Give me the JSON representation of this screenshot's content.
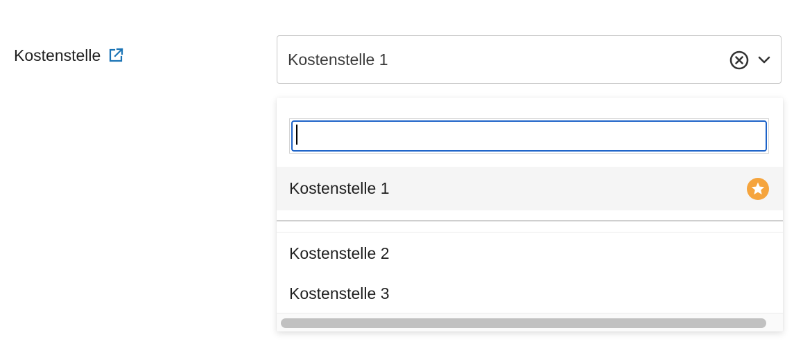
{
  "field": {
    "label": "Kostenstelle",
    "link_icon": "external-link-icon",
    "link_color": "#1a73b5"
  },
  "select": {
    "value": "Kostenstelle 1",
    "clear_icon": "clear-circle-x-icon",
    "toggle_icon": "chevron-down-icon"
  },
  "dropdown": {
    "search": {
      "value": "",
      "placeholder": ""
    },
    "favorites": [
      {
        "label": "Kostenstelle 1",
        "icon": "favorite-star-icon",
        "icon_color": "#f5a43d",
        "selected": true
      }
    ],
    "options": [
      {
        "label": "Kostenstelle 2"
      },
      {
        "label": "Kostenstelle 3"
      }
    ]
  },
  "colors": {
    "focus_border": "#1d63c8",
    "selected_bg": "#f5f5f5"
  }
}
